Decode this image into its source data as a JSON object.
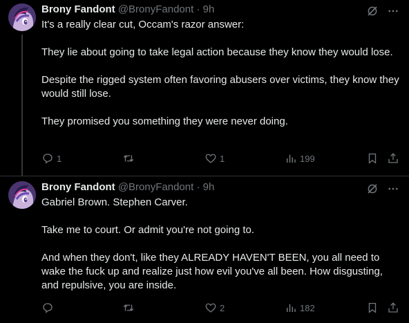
{
  "tweets": [
    {
      "display_name": "Brony Fandont",
      "handle": "@BronyFandont",
      "separator": "·",
      "time": "9h",
      "paragraphs": [
        "It's a really clear cut, Occam's razor answer:",
        "They lie about going to take legal action because they know they would lose.",
        "Despite the rigged system often favoring abusers over victims, they know they would still lose.",
        "They promised you something they were never doing."
      ],
      "replies": "1",
      "retweets": "",
      "likes": "1",
      "views": "199"
    },
    {
      "display_name": "Brony Fandont",
      "handle": "@BronyFandont",
      "separator": "·",
      "time": "9h",
      "paragraphs": [
        "Gabriel Brown. Stephen Carver.",
        "Take me to court. Or admit you're not going to.",
        "And when they don't, like they ALREADY HAVEN'T BEEN, you all need to wake the fuck up and realize just how evil you've all been. How disgusting, and repulsive, you are inside."
      ],
      "replies": "",
      "retweets": "",
      "likes": "2",
      "views": "182"
    }
  ],
  "colors": {
    "background": "#000000",
    "text": "#e7e9ea",
    "secondary": "#71767b",
    "divider": "#2f3336"
  },
  "icons": [
    "avatar",
    "grok-icon",
    "more-icon",
    "reply-icon",
    "retweet-icon",
    "like-icon",
    "views-icon",
    "bookmark-icon",
    "share-icon"
  ]
}
